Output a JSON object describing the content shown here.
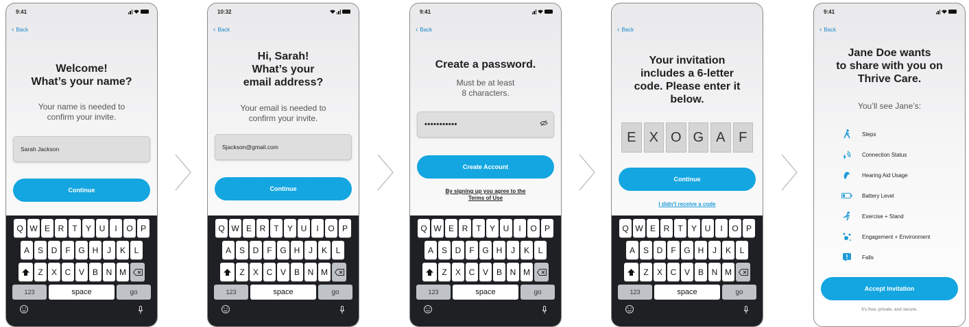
{
  "screens": [
    {
      "status_time": "9:41",
      "back_label": "Back",
      "title": "Welcome!\nWhat’s your name?",
      "subtitle": "Your name is needed to\nconfirm your invite.",
      "input_value": "Sarah Jackson",
      "button_label": "Continue"
    },
    {
      "status_time": "10:32",
      "back_label": "Back",
      "title": "Hi, Sarah!\nWhat’s your\nemail address?",
      "subtitle": "Your email is needed to\nconfirm your invite.",
      "input_value": "Sjackson@gmail.com",
      "button_label": "Continue"
    },
    {
      "status_time": "9:41",
      "back_label": "Back",
      "title": "Create a password.",
      "subtitle": "Must be at least\n8 characters.",
      "input_value": "•••••••••••",
      "eye_icon": "eye-slash-icon",
      "button_label": "Create Account",
      "terms_link": "By signing up you agree to the\nTerms of Use"
    },
    {
      "back_label": "Back",
      "title": "Your invitation\nincludes a 6-letter\ncode. Please enter it\nbelow.",
      "code_letters": [
        "E",
        "X",
        "O",
        "G",
        "A",
        "F"
      ],
      "button_label": "Continue",
      "resend_link": "I didn't receive a code"
    },
    {
      "status_time": "9:41",
      "back_label": "Back",
      "title": "Jane Doe wants\nto share with you on\nThrive Care.",
      "subtitle": "You’ll see Jane’s:",
      "share_items": [
        {
          "label": "Steps",
          "icon": "walking-icon"
        },
        {
          "label": "Connection Status",
          "icon": "connection-status-icon"
        },
        {
          "label": "Hearing Aid Usage",
          "icon": "hearing-aid-icon"
        },
        {
          "label": "Battery Level",
          "icon": "battery-icon"
        },
        {
          "label": "Exercise + Stand",
          "icon": "running-icon"
        },
        {
          "label": "Engagement + Environment",
          "icon": "engagement-icon"
        },
        {
          "label": "Falls",
          "icon": "falls-alert-icon"
        }
      ],
      "button_label": "Accept Invitation",
      "footnote": "It's free, private, and secure."
    }
  ],
  "keyboard": {
    "row1": [
      "Q",
      "W",
      "E",
      "R",
      "T",
      "Y",
      "U",
      "I",
      "O",
      "P"
    ],
    "row2": [
      "A",
      "S",
      "D",
      "F",
      "G",
      "H",
      "J",
      "K",
      "L"
    ],
    "row3": [
      "Z",
      "X",
      "C",
      "V",
      "B",
      "N",
      "M"
    ],
    "numbers_key": "123",
    "space_key": "space",
    "go_key": "go"
  },
  "colors": {
    "accent": "#14a6e0",
    "link": "#1e9ad6",
    "keyboard_bg": "#1f2024"
  }
}
